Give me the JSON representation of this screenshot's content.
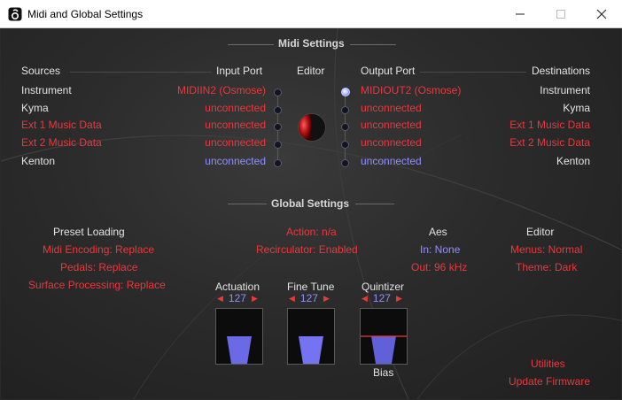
{
  "window": {
    "title": "Midi and Global Settings"
  },
  "midi": {
    "heading": "Midi Settings",
    "columns": {
      "sources": "Sources",
      "input_port": "Input Port",
      "editor": "Editor",
      "output_port": "Output Port",
      "destinations": "Destinations"
    },
    "rows": [
      {
        "source": "Instrument",
        "input": "MIDIIN2 (Osmose)",
        "output": "MIDIOUT2 (Osmose)",
        "destination": "Instrument"
      },
      {
        "source": "Kyma",
        "input": "unconnected",
        "output": "unconnected",
        "destination": "Kyma"
      },
      {
        "source": "Ext 1 Music Data",
        "input": "unconnected",
        "output": "unconnected",
        "destination": "Ext 1 Music Data"
      },
      {
        "source": "Ext 2 Music Data",
        "input": "unconnected",
        "output": "unconnected",
        "destination": "Ext 2 Music Data"
      },
      {
        "source": "Kenton",
        "input": "unconnected",
        "output": "unconnected",
        "destination": "Kenton"
      }
    ]
  },
  "global": {
    "heading": "Global Settings",
    "preset_loading": {
      "title": "Preset Loading",
      "midi_encoding": "Midi Encoding: Replace",
      "pedals": "Pedals: Replace",
      "surface_processing": "Surface Processing: Replace"
    },
    "action": "Action: n/a",
    "recirculator": "Recirculator: Enabled",
    "aes": {
      "title": "Aes",
      "in": "In: None",
      "out": "Out: 96 kHz"
    },
    "editor": {
      "title": "Editor",
      "menus": "Menus: Normal",
      "theme": "Theme: Dark"
    },
    "sliders": [
      {
        "label": "Actuation",
        "value": "127",
        "level": 0.5
      },
      {
        "label": "Fine Tune",
        "value": "127",
        "level": 0.5
      },
      {
        "label": "Quintizer",
        "value": "127",
        "level": 0.5
      }
    ],
    "bias_label": "Bias",
    "utilities": "Utilities",
    "update_firmware": "Update Firmware"
  },
  "colors": {
    "red": "#e8393c",
    "blue": "#8f8fff",
    "white": "#e4e4e4",
    "slider_fill": "#6e6ee8"
  }
}
